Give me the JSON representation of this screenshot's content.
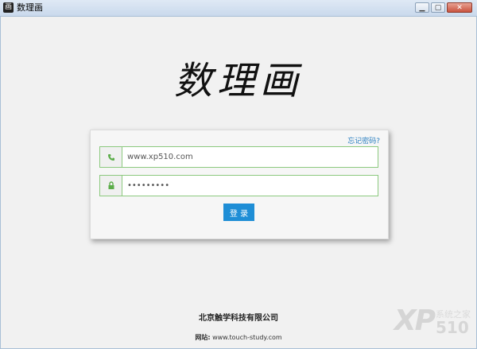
{
  "window": {
    "title": "数理画",
    "icon_glyph": "画",
    "buttons": {
      "minimize": "minimize-icon",
      "maximize": "maximize-icon",
      "close": "close-icon"
    }
  },
  "logo": {
    "text": "数理画"
  },
  "login": {
    "forgot_password": "忘记密码?",
    "phone": {
      "value": "www.xp510.com",
      "icon": "phone-icon"
    },
    "password": {
      "value": "•••••••••",
      "icon": "lock-icon"
    },
    "submit_label": "登 录"
  },
  "footer": {
    "company": "北京触学科技有限公司",
    "website_label": "网站:",
    "website_url": "www.touch-study.com"
  },
  "watermark": {
    "xp": "XP",
    "cn": "系统之家",
    "num": "510"
  },
  "colors": {
    "accent": "#1f8ed6",
    "field_border": "#8cc97e",
    "icon_green": "#5cad4a"
  }
}
